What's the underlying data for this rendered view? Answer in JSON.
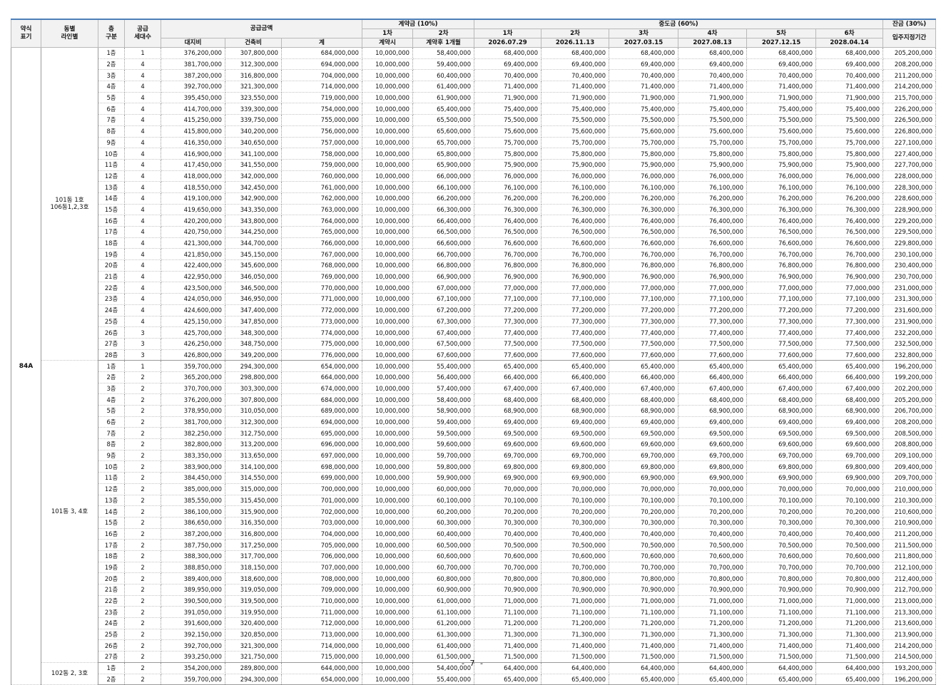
{
  "header": {
    "type": "약식\n표기",
    "line": "동별\n라인별",
    "floor": "층\n구분",
    "units": "공급\n세대수",
    "supply": "공급금액",
    "land": "대지비",
    "building": "건축비",
    "total": "계",
    "deposit": "계약금 (10%)",
    "dep1": "1차",
    "dep2": "2차",
    "dep1_when": "계약시",
    "dep2_when": "계약후 1개월",
    "middle": "중도금 (60%)",
    "mid_labels": [
      "1차",
      "2차",
      "3차",
      "4차",
      "5차",
      "6차"
    ],
    "mid_dates": [
      "2026.07.29",
      "2026.11.13",
      "2027.03.15",
      "2027.08.13",
      "2027.12.15",
      "2028.04.14"
    ],
    "balance": "잔금 (30%)",
    "balance_when": "입주지정기간"
  },
  "type_label": "84A",
  "groups": [
    {
      "label": "101동 1호\n106동1,2,3호",
      "rows": [
        [
          "1층",
          "1",
          "376,200,000",
          "307,800,000",
          "684,000,000",
          "10,000,000",
          "58,400,000",
          "68,400,000",
          "205,200,000"
        ],
        [
          "2층",
          "4",
          "381,700,000",
          "312,300,000",
          "694,000,000",
          "10,000,000",
          "59,400,000",
          "69,400,000",
          "208,200,000"
        ],
        [
          "3층",
          "4",
          "387,200,000",
          "316,800,000",
          "704,000,000",
          "10,000,000",
          "60,400,000",
          "70,400,000",
          "211,200,000"
        ],
        [
          "4층",
          "4",
          "392,700,000",
          "321,300,000",
          "714,000,000",
          "10,000,000",
          "61,400,000",
          "71,400,000",
          "214,200,000"
        ],
        [
          "5층",
          "4",
          "395,450,000",
          "323,550,000",
          "719,000,000",
          "10,000,000",
          "61,900,000",
          "71,900,000",
          "215,700,000"
        ],
        [
          "6층",
          "4",
          "414,700,000",
          "339,300,000",
          "754,000,000",
          "10,000,000",
          "65,400,000",
          "75,400,000",
          "226,200,000"
        ],
        [
          "7층",
          "4",
          "415,250,000",
          "339,750,000",
          "755,000,000",
          "10,000,000",
          "65,500,000",
          "75,500,000",
          "226,500,000"
        ],
        [
          "8층",
          "4",
          "415,800,000",
          "340,200,000",
          "756,000,000",
          "10,000,000",
          "65,600,000",
          "75,600,000",
          "226,800,000"
        ],
        [
          "9층",
          "4",
          "416,350,000",
          "340,650,000",
          "757,000,000",
          "10,000,000",
          "65,700,000",
          "75,700,000",
          "227,100,000"
        ],
        [
          "10층",
          "4",
          "416,900,000",
          "341,100,000",
          "758,000,000",
          "10,000,000",
          "65,800,000",
          "75,800,000",
          "227,400,000"
        ],
        [
          "11층",
          "4",
          "417,450,000",
          "341,550,000",
          "759,000,000",
          "10,000,000",
          "65,900,000",
          "75,900,000",
          "227,700,000"
        ],
        [
          "12층",
          "4",
          "418,000,000",
          "342,000,000",
          "760,000,000",
          "10,000,000",
          "66,000,000",
          "76,000,000",
          "228,000,000"
        ],
        [
          "13층",
          "4",
          "418,550,000",
          "342,450,000",
          "761,000,000",
          "10,000,000",
          "66,100,000",
          "76,100,000",
          "228,300,000"
        ],
        [
          "14층",
          "4",
          "419,100,000",
          "342,900,000",
          "762,000,000",
          "10,000,000",
          "66,200,000",
          "76,200,000",
          "228,600,000"
        ],
        [
          "15층",
          "4",
          "419,650,000",
          "343,350,000",
          "763,000,000",
          "10,000,000",
          "66,300,000",
          "76,300,000",
          "228,900,000"
        ],
        [
          "16층",
          "4",
          "420,200,000",
          "343,800,000",
          "764,000,000",
          "10,000,000",
          "66,400,000",
          "76,400,000",
          "229,200,000"
        ],
        [
          "17층",
          "4",
          "420,750,000",
          "344,250,000",
          "765,000,000",
          "10,000,000",
          "66,500,000",
          "76,500,000",
          "229,500,000"
        ],
        [
          "18층",
          "4",
          "421,300,000",
          "344,700,000",
          "766,000,000",
          "10,000,000",
          "66,600,000",
          "76,600,000",
          "229,800,000"
        ],
        [
          "19층",
          "4",
          "421,850,000",
          "345,150,000",
          "767,000,000",
          "10,000,000",
          "66,700,000",
          "76,700,000",
          "230,100,000"
        ],
        [
          "20층",
          "4",
          "422,400,000",
          "345,600,000",
          "768,000,000",
          "10,000,000",
          "66,800,000",
          "76,800,000",
          "230,400,000"
        ],
        [
          "21층",
          "4",
          "422,950,000",
          "346,050,000",
          "769,000,000",
          "10,000,000",
          "66,900,000",
          "76,900,000",
          "230,700,000"
        ],
        [
          "22층",
          "4",
          "423,500,000",
          "346,500,000",
          "770,000,000",
          "10,000,000",
          "67,000,000",
          "77,000,000",
          "231,000,000"
        ],
        [
          "23층",
          "4",
          "424,050,000",
          "346,950,000",
          "771,000,000",
          "10,000,000",
          "67,100,000",
          "77,100,000",
          "231,300,000"
        ],
        [
          "24층",
          "4",
          "424,600,000",
          "347,400,000",
          "772,000,000",
          "10,000,000",
          "67,200,000",
          "77,200,000",
          "231,600,000"
        ],
        [
          "25층",
          "4",
          "425,150,000",
          "347,850,000",
          "773,000,000",
          "10,000,000",
          "67,300,000",
          "77,300,000",
          "231,900,000"
        ],
        [
          "26층",
          "3",
          "425,700,000",
          "348,300,000",
          "774,000,000",
          "10,000,000",
          "67,400,000",
          "77,400,000",
          "232,200,000"
        ],
        [
          "27층",
          "3",
          "426,250,000",
          "348,750,000",
          "775,000,000",
          "10,000,000",
          "67,500,000",
          "77,500,000",
          "232,500,000"
        ],
        [
          "28층",
          "3",
          "426,800,000",
          "349,200,000",
          "776,000,000",
          "10,000,000",
          "67,600,000",
          "77,600,000",
          "232,800,000"
        ]
      ]
    },
    {
      "label": "101동 3, 4호",
      "rows": [
        [
          "1층",
          "1",
          "359,700,000",
          "294,300,000",
          "654,000,000",
          "10,000,000",
          "55,400,000",
          "65,400,000",
          "196,200,000"
        ],
        [
          "2층",
          "2",
          "365,200,000",
          "298,800,000",
          "664,000,000",
          "10,000,000",
          "56,400,000",
          "66,400,000",
          "199,200,000"
        ],
        [
          "3층",
          "2",
          "370,700,000",
          "303,300,000",
          "674,000,000",
          "10,000,000",
          "57,400,000",
          "67,400,000",
          "202,200,000"
        ],
        [
          "4층",
          "2",
          "376,200,000",
          "307,800,000",
          "684,000,000",
          "10,000,000",
          "58,400,000",
          "68,400,000",
          "205,200,000"
        ],
        [
          "5층",
          "2",
          "378,950,000",
          "310,050,000",
          "689,000,000",
          "10,000,000",
          "58,900,000",
          "68,900,000",
          "206,700,000"
        ],
        [
          "6층",
          "2",
          "381,700,000",
          "312,300,000",
          "694,000,000",
          "10,000,000",
          "59,400,000",
          "69,400,000",
          "208,200,000"
        ],
        [
          "7층",
          "2",
          "382,250,000",
          "312,750,000",
          "695,000,000",
          "10,000,000",
          "59,500,000",
          "69,500,000",
          "208,500,000"
        ],
        [
          "8층",
          "2",
          "382,800,000",
          "313,200,000",
          "696,000,000",
          "10,000,000",
          "59,600,000",
          "69,600,000",
          "208,800,000"
        ],
        [
          "9층",
          "2",
          "383,350,000",
          "313,650,000",
          "697,000,000",
          "10,000,000",
          "59,700,000",
          "69,700,000",
          "209,100,000"
        ],
        [
          "10층",
          "2",
          "383,900,000",
          "314,100,000",
          "698,000,000",
          "10,000,000",
          "59,800,000",
          "69,800,000",
          "209,400,000"
        ],
        [
          "11층",
          "2",
          "384,450,000",
          "314,550,000",
          "699,000,000",
          "10,000,000",
          "59,900,000",
          "69,900,000",
          "209,700,000"
        ],
        [
          "12층",
          "2",
          "385,000,000",
          "315,000,000",
          "700,000,000",
          "10,000,000",
          "60,000,000",
          "70,000,000",
          "210,000,000"
        ],
        [
          "13층",
          "2",
          "385,550,000",
          "315,450,000",
          "701,000,000",
          "10,000,000",
          "60,100,000",
          "70,100,000",
          "210,300,000"
        ],
        [
          "14층",
          "2",
          "386,100,000",
          "315,900,000",
          "702,000,000",
          "10,000,000",
          "60,200,000",
          "70,200,000",
          "210,600,000"
        ],
        [
          "15층",
          "2",
          "386,650,000",
          "316,350,000",
          "703,000,000",
          "10,000,000",
          "60,300,000",
          "70,300,000",
          "210,900,000"
        ],
        [
          "16층",
          "2",
          "387,200,000",
          "316,800,000",
          "704,000,000",
          "10,000,000",
          "60,400,000",
          "70,400,000",
          "211,200,000"
        ],
        [
          "17층",
          "2",
          "387,750,000",
          "317,250,000",
          "705,000,000",
          "10,000,000",
          "60,500,000",
          "70,500,000",
          "211,500,000"
        ],
        [
          "18층",
          "2",
          "388,300,000",
          "317,700,000",
          "706,000,000",
          "10,000,000",
          "60,600,000",
          "70,600,000",
          "211,800,000"
        ],
        [
          "19층",
          "2",
          "388,850,000",
          "318,150,000",
          "707,000,000",
          "10,000,000",
          "60,700,000",
          "70,700,000",
          "212,100,000"
        ],
        [
          "20층",
          "2",
          "389,400,000",
          "318,600,000",
          "708,000,000",
          "10,000,000",
          "60,800,000",
          "70,800,000",
          "212,400,000"
        ],
        [
          "21층",
          "2",
          "389,950,000",
          "319,050,000",
          "709,000,000",
          "10,000,000",
          "60,900,000",
          "70,900,000",
          "212,700,000"
        ],
        [
          "22층",
          "2",
          "390,500,000",
          "319,500,000",
          "710,000,000",
          "10,000,000",
          "61,000,000",
          "71,000,000",
          "213,000,000"
        ],
        [
          "23층",
          "2",
          "391,050,000",
          "319,950,000",
          "711,000,000",
          "10,000,000",
          "61,100,000",
          "71,100,000",
          "213,300,000"
        ],
        [
          "24층",
          "2",
          "391,600,000",
          "320,400,000",
          "712,000,000",
          "10,000,000",
          "61,200,000",
          "71,200,000",
          "213,600,000"
        ],
        [
          "25층",
          "2",
          "392,150,000",
          "320,850,000",
          "713,000,000",
          "10,000,000",
          "61,300,000",
          "71,300,000",
          "213,900,000"
        ],
        [
          "26층",
          "2",
          "392,700,000",
          "321,300,000",
          "714,000,000",
          "10,000,000",
          "61,400,000",
          "71,400,000",
          "214,200,000"
        ],
        [
          "27층",
          "2",
          "393,250,000",
          "321,750,000",
          "715,000,000",
          "10,000,000",
          "61,500,000",
          "71,500,000",
          "214,500,000"
        ]
      ]
    },
    {
      "label": "102동 2, 3호",
      "rows": [
        [
          "1층",
          "2",
          "354,200,000",
          "289,800,000",
          "644,000,000",
          "10,000,000",
          "54,400,000",
          "64,400,000",
          "193,200,000"
        ],
        [
          "2층",
          "2",
          "359,700,000",
          "294,300,000",
          "654,000,000",
          "10,000,000",
          "55,400,000",
          "65,400,000",
          "196,200,000"
        ]
      ]
    }
  ],
  "page_number": "- 7 -"
}
